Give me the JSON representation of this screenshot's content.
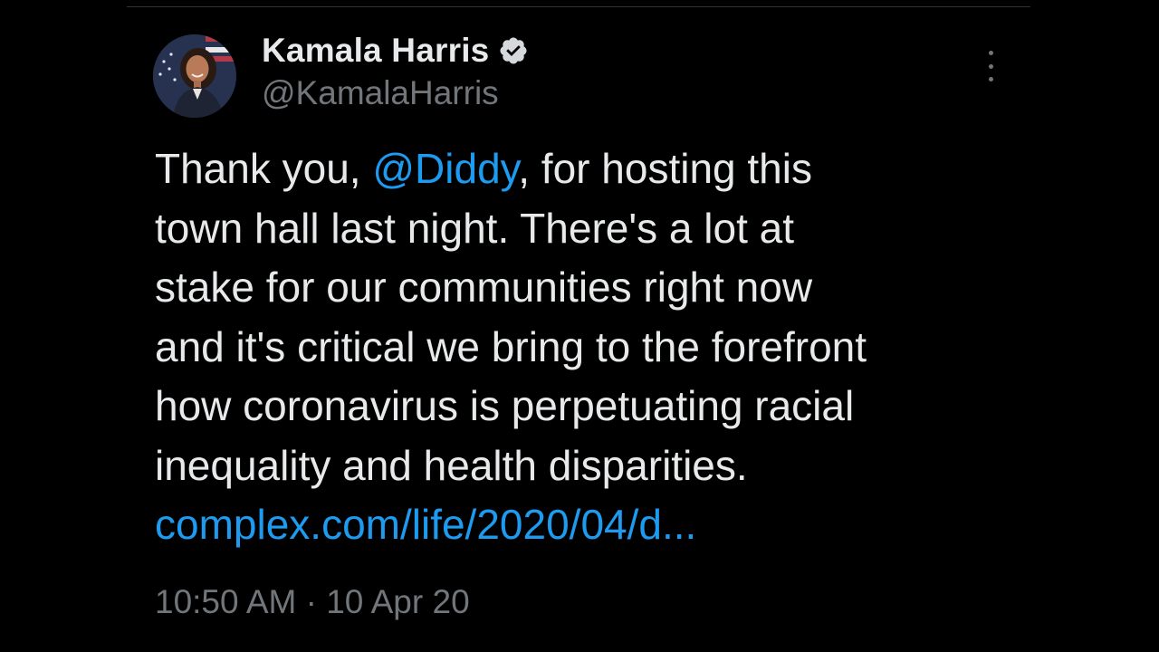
{
  "author": {
    "display_name": "Kamala Harris",
    "handle": "@KamalaHarris",
    "verified": true,
    "avatar_icon": "profile-photo"
  },
  "tweet": {
    "line1_before": "Thank you, ",
    "mention": "@Diddy",
    "line1_after": ", for hosting this",
    "line2": "town hall last night. There's a lot at",
    "line3": "stake for our communities right now",
    "line4": "and it's critical we bring to the forefront",
    "line5": "how coronavirus is perpetuating racial",
    "line6": "inequality and health disparities.",
    "link": "complex.com/life/2020/04/d..."
  },
  "meta": {
    "time": "10:50 AM",
    "separator": " · ",
    "date": "10 Apr 20"
  },
  "colors": {
    "background": "#000000",
    "text": "#e7e9ea",
    "secondary": "#71767b",
    "accent": "#1d9bf0"
  }
}
